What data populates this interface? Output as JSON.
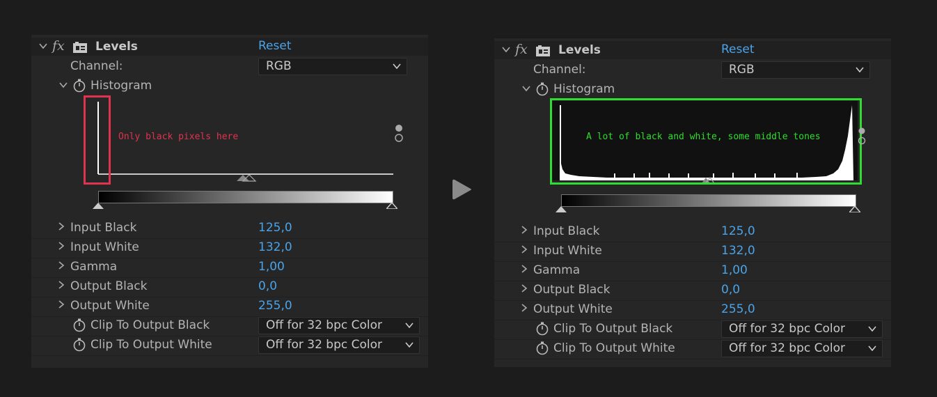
{
  "panels": [
    {
      "effect": {
        "title": "Levels",
        "reset": "Reset"
      },
      "channel": {
        "label": "Channel:",
        "value": "RGB"
      },
      "histogram": {
        "label": "Histogram"
      },
      "annotation": {
        "text": "Only black pixels here",
        "color": "#e0334f"
      },
      "params": [
        {
          "label": "Input Black",
          "value": "125,0"
        },
        {
          "label": "Input White",
          "value": "132,0"
        },
        {
          "label": "Gamma",
          "value": "1,00"
        },
        {
          "label": "Output Black",
          "value": "0,0"
        },
        {
          "label": "Output White",
          "value": "255,0"
        }
      ],
      "clips": [
        {
          "label": "Clip To Output Black",
          "value": "Off for 32 bpc Color"
        },
        {
          "label": "Clip To Output White",
          "value": "Off for 32 bpc Color"
        }
      ]
    },
    {
      "effect": {
        "title": "Levels",
        "reset": "Reset"
      },
      "channel": {
        "label": "Channel:",
        "value": "RGB"
      },
      "histogram": {
        "label": "Histogram"
      },
      "annotation": {
        "text": "A lot of black and white, some middle tones",
        "color": "#2fdc2f"
      },
      "params": [
        {
          "label": "Input Black",
          "value": "125,0"
        },
        {
          "label": "Input White",
          "value": "132,0"
        },
        {
          "label": "Gamma",
          "value": "1,00"
        },
        {
          "label": "Output Black",
          "value": "0,0"
        },
        {
          "label": "Output White",
          "value": "255,0"
        }
      ],
      "clips": [
        {
          "label": "Clip To Output Black",
          "value": "Off for 32 bpc Color"
        },
        {
          "label": "Clip To Output White",
          "value": "Off for 32 bpc Color"
        }
      ]
    }
  ],
  "colors": {
    "accent": "#4ba3e8",
    "panel_bg": "#262626",
    "page_bg": "#1c1c1c"
  },
  "icons": {
    "arrow": "play-arrow-icon",
    "fx": "fx-icon",
    "effect": "effect-icon",
    "stopwatch": "stopwatch-icon",
    "twirl": "chevron-icon"
  }
}
